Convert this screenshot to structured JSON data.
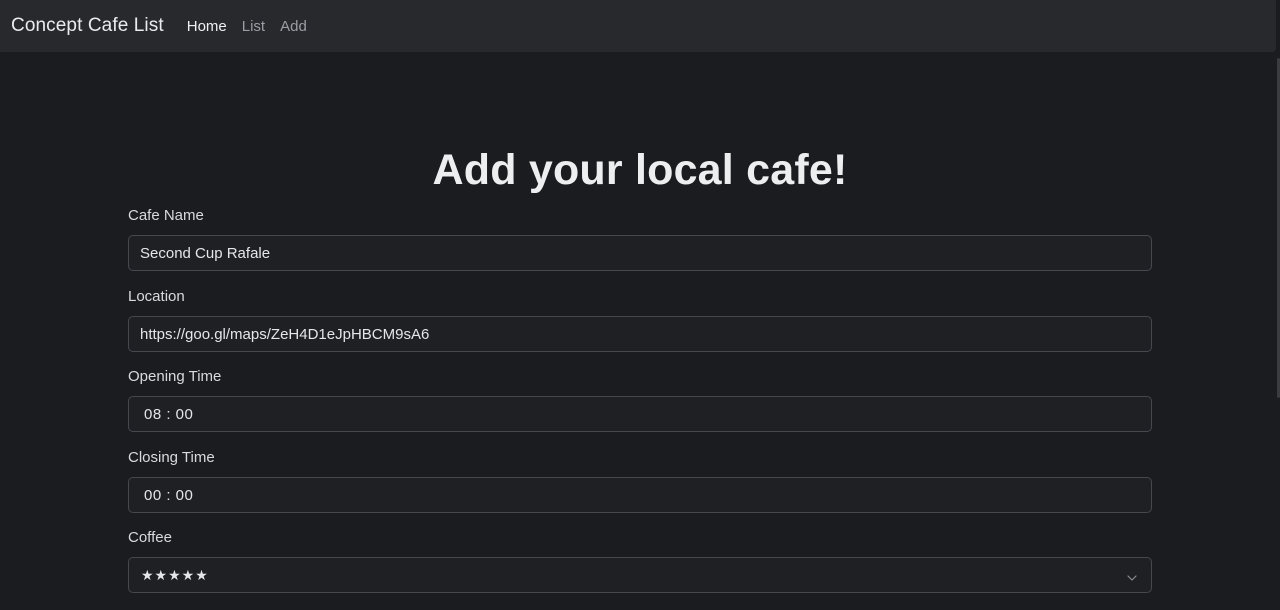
{
  "navbar": {
    "brand": "Concept Cafe List",
    "links": [
      {
        "label": "Home",
        "active": true
      },
      {
        "label": "List",
        "active": false
      },
      {
        "label": "Add",
        "active": false
      }
    ]
  },
  "page": {
    "title": "Add your local cafe!"
  },
  "form": {
    "cafe_name": {
      "label": "Cafe Name",
      "value": "Second Cup Rafale"
    },
    "location": {
      "label": "Location",
      "value": "https://goo.gl/maps/ZeH4D1eJpHBCM9sA6"
    },
    "opening_time": {
      "label": "Opening Time",
      "value": "08 : 00"
    },
    "closing_time": {
      "label": "Closing Time",
      "value": "00 : 00"
    },
    "coffee": {
      "label": "Coffee",
      "value": "★★★★★",
      "icon": "chevron-down-icon"
    }
  },
  "colors": {
    "background": "#1b1c1f",
    "navbar": "#27292d",
    "input_background": "#1f2024",
    "input_border": "#45484d"
  }
}
